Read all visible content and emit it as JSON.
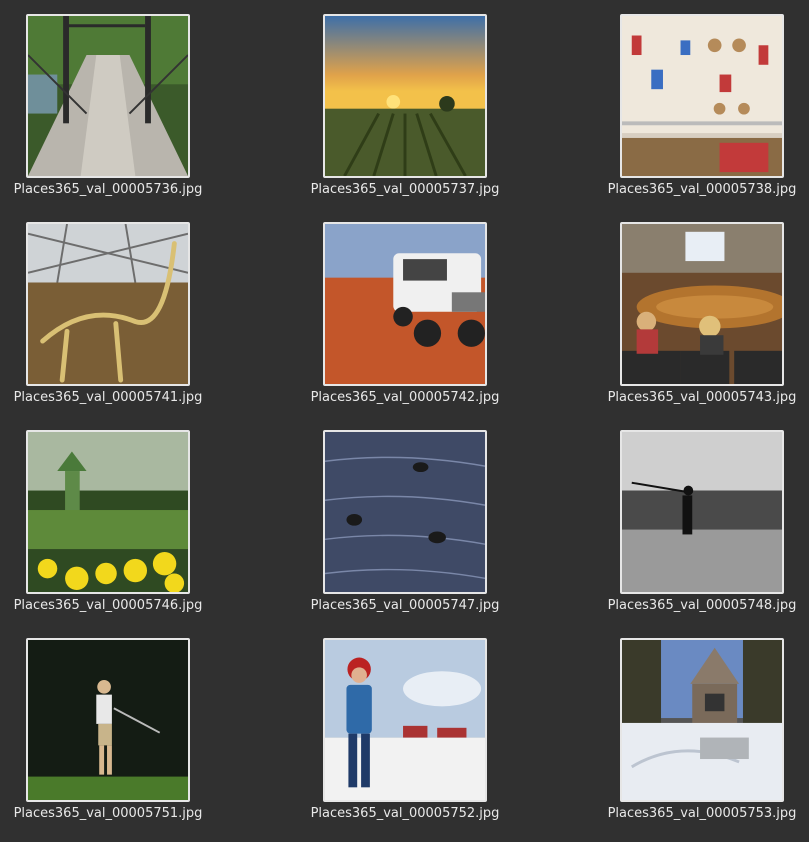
{
  "files": [
    {
      "name": "Places365_val_00005736.jpg",
      "icon": "footbridge-photo-icon"
    },
    {
      "name": "Places365_val_00005737.jpg",
      "icon": "vineyard-sunset-photo-icon"
    },
    {
      "name": "Places365_val_00005738.jpg",
      "icon": "store-shelves-photo-icon"
    },
    {
      "name": "Places365_val_00005741.jpg",
      "icon": "dinosaur-skeleton-photo-icon"
    },
    {
      "name": "Places365_val_00005742.jpg",
      "icon": "white-suv-desert-photo-icon"
    },
    {
      "name": "Places365_val_00005743.jpg",
      "icon": "conference-room-photo-icon"
    },
    {
      "name": "Places365_val_00005746.jpg",
      "icon": "garden-flowers-photo-icon"
    },
    {
      "name": "Places365_val_00005747.jpg",
      "icon": "geese-water-photo-icon"
    },
    {
      "name": "Places365_val_00005748.jpg",
      "icon": "beach-fishing-photo-icon"
    },
    {
      "name": "Places365_val_00005751.jpg",
      "icon": "golfer-photo-icon"
    },
    {
      "name": "Places365_val_00005752.jpg",
      "icon": "child-snow-photo-icon"
    },
    {
      "name": "Places365_val_00005753.jpg",
      "icon": "snowy-house-photo-icon"
    }
  ]
}
